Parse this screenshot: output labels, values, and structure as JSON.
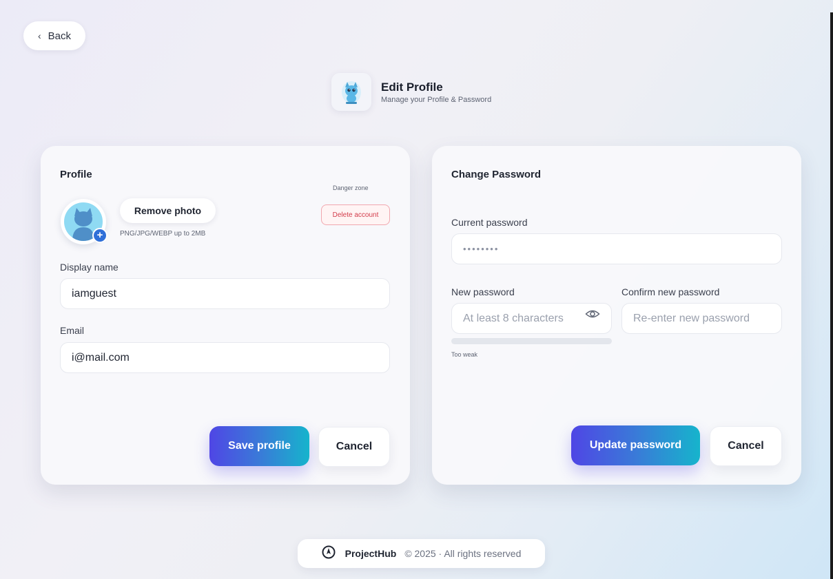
{
  "nav": {
    "back_label": "Back"
  },
  "header": {
    "title": "Edit Profile",
    "subtitle": "Manage your Profile & Password"
  },
  "profile": {
    "title": "Profile",
    "remove_photo_label": "Remove photo",
    "photo_hint": "PNG/JPG/WEBP up to 2MB",
    "danger_zone_label": "Danger zone",
    "delete_account_label": "Delete account",
    "display_name_label": "Display name",
    "display_name_value": "iamguest",
    "email_label": "Email",
    "email_value": "i@mail.com",
    "save_label": "Save profile",
    "cancel_label": "Cancel"
  },
  "password": {
    "title": "Change Password",
    "current_label": "Current password",
    "current_value": "••••••••",
    "new_label": "New password",
    "new_placeholder": "At least 8 characters",
    "confirm_label": "Confirm new password",
    "confirm_placeholder": "Re-enter new password",
    "strength_label": "Too weak",
    "strength_level": 0,
    "update_label": "Update password",
    "cancel_label": "Cancel"
  },
  "footer": {
    "brand": "ProjectHub",
    "copyright": "© 2025 · All rights reserved"
  },
  "colors": {
    "accent_start": "#4f46e5",
    "accent_end": "#16b4cc",
    "danger": "#d23b4a",
    "avatar_badge": "#2f6fd8"
  },
  "icons": {
    "back": "chevron-left-icon",
    "logo": "cat-mascot-icon",
    "avatar_add": "plus-icon",
    "password_toggle": "eye-icon",
    "brand": "compass-icon"
  }
}
